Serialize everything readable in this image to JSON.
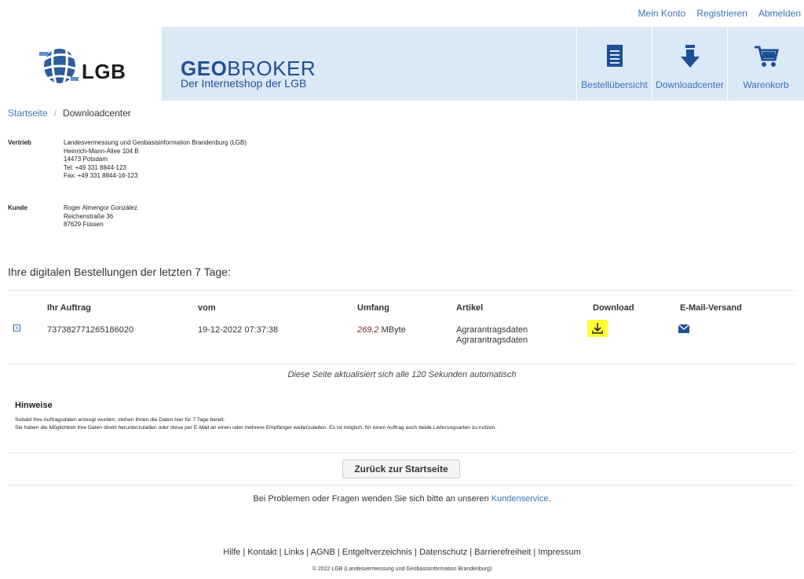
{
  "toplinks": {
    "account": "Mein Konto",
    "register": "Registrieren",
    "logout": "Abmelden"
  },
  "logo": {
    "text": "LGB"
  },
  "banner": {
    "title_bold": "GEO",
    "title_rest": "BROKER",
    "subtitle": "Der Internetshop der LGB"
  },
  "nav": {
    "orders": "Bestellübersicht",
    "downloads": "Downloadcenter",
    "cart": "Warenkorb"
  },
  "breadcrumb": {
    "home": "Startseite",
    "separator": "/",
    "current": "Downloadcenter"
  },
  "vertrieb": {
    "label": "Vertrieb",
    "lines": [
      "Landesvermessung und Geobasisinformation Brandenburg (LGB)",
      "Heinrich-Mann-Allee 104 B",
      "14473 Potsdam",
      "Tel: +49 331 8844-123",
      "Fax: +49 331 8844-16-123"
    ]
  },
  "kunde": {
    "label": "Kunde",
    "lines": [
      "Roger Almengor González",
      "Reichenstraße 36",
      "87629 Füssen"
    ]
  },
  "orders": {
    "title": "Ihre digitalen Bestellungen der letzten 7 Tage:",
    "headers": {
      "order": "Ihr Auftrag",
      "date": "vom",
      "size": "Umfang",
      "article": "Artikel",
      "download": "Download",
      "email": "E-Mail-Versand"
    },
    "rows": [
      {
        "expand": "+",
        "order": "737382771265186020",
        "date": "19-12-2022 07:37:38",
        "size_value": "269.2",
        "size_unit": "MByte",
        "article_1": "Agrarantragsdaten",
        "article_2": "Agrarantragsdaten"
      }
    ]
  },
  "autorefresh": "Diese Seite aktualisiert sich alle 120 Sekunden automatisch",
  "hints": {
    "title": "Hinweise",
    "line1": "Sobald Ihre Auftragsdaten erzeugt wurden, stehen Ihnen die Daten hier für 7 Tage bereit.",
    "line2": "Sie haben die Möglichkeit Ihre Daten direkt herunterzuladen oder diese per E-Mail an einen oder mehrere Empfänger weiterzuleiten. Es ist möglich, für einen Auftrag auch beide Lieferungsarten zu nutzen."
  },
  "back_button": "Zurück zur Startseite",
  "problem": {
    "text": "Bei Problemen oder Fragen wenden Sie sich bitte an unseren ",
    "link": "Kundenservice",
    "end": "."
  },
  "footer": {
    "links": [
      "Hilfe",
      "Kontakt",
      "Links",
      "AGNB",
      "Entgeltverzeichnis",
      "Datenschutz",
      "Barrierefreiheit",
      "Impressum"
    ],
    "separator": " | ",
    "copyright": "© 2022 LGB (Landesvermessung und Geobasisinformation Brandenburg)"
  },
  "colors": {
    "link": "#3b73b9",
    "banner_bg": "#dbe8f6",
    "brand_blue": "#1f4f96",
    "highlight": "#ffff33"
  }
}
